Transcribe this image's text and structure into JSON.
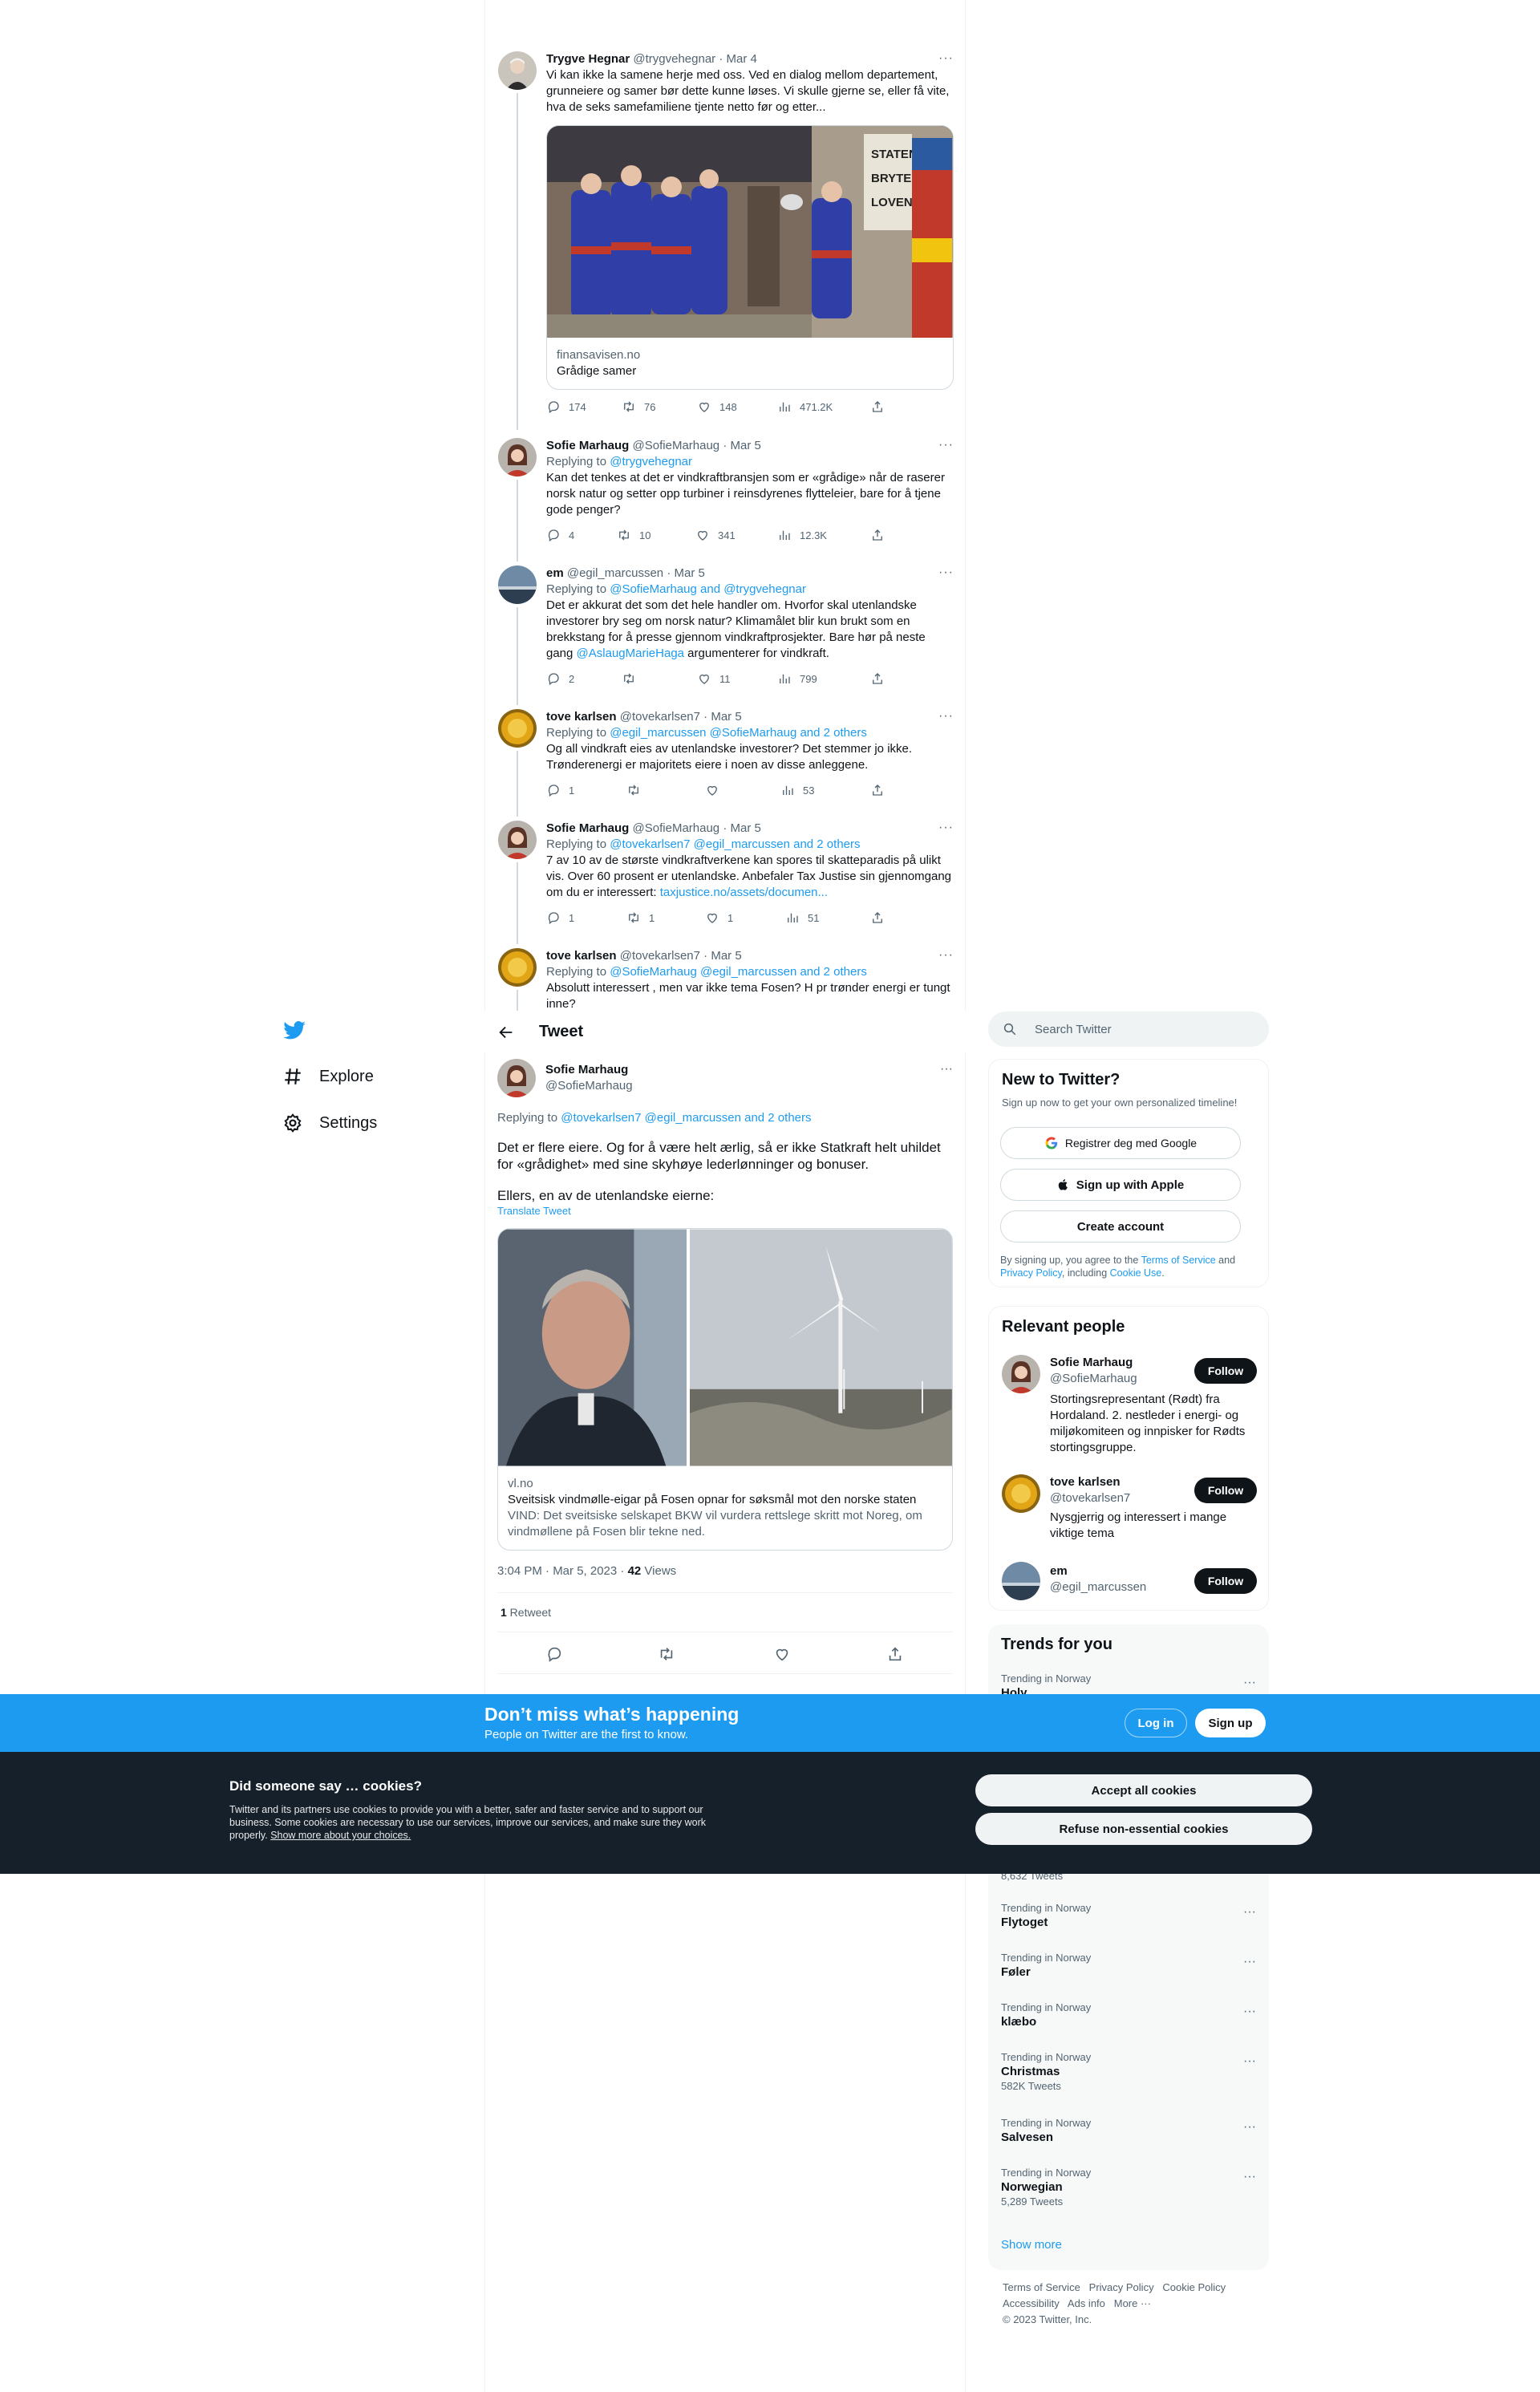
{
  "thread": [
    {
      "name": "Trygve Hegnar",
      "handle": "@trygvehegnar",
      "date": "· Mar 4",
      "text": "Vi kan ikke la samene herje med oss. Ved en dialog mellom departement, grunneiere og samer bør dette kunne løses. Vi skulle gjerne se, eller få vite, hva de seks samefamiliene tjente netto før og etter...",
      "card_domain": "finansavisen.no",
      "card_title": "Grådige samer",
      "counts": {
        "reply": "174",
        "retweet": "76",
        "like": "148",
        "views": "471.2K"
      }
    },
    {
      "name": "Sofie Marhaug",
      "handle": "@SofieMarhaug",
      "date": "· Mar 5",
      "replying_prefix": "Replying to ",
      "replying_to": "@trygvehegnar",
      "text": "Kan det tenkes at det er vindkraftbransjen som er «grådige» når de raserer norsk natur og setter opp turbiner i reinsdyrenes flytteleier, bare for å tjene gode penger?",
      "counts": {
        "reply": "4",
        "retweet": "10",
        "like": "341",
        "views": "12.3K"
      }
    },
    {
      "name": "em",
      "handle": "@egil_marcussen",
      "date": "· Mar 5",
      "replying_prefix": "Replying to ",
      "replying_to": "@SofieMarhaug and @trygvehegnar",
      "text_a": "Det er akkurat det som det hele handler om. Hvorfor skal utenlandske investorer bry seg om norsk natur? Klimamålet blir kun brukt som en brekkstang for å presse gjennom vindkraftprosjekter. Bare hør på neste gang ",
      "mention": "@AslaugMarieHaga",
      "text_b": " argumenterer for vindkraft.",
      "counts": {
        "reply": "2",
        "retweet": "",
        "like": "11",
        "views": "799"
      }
    },
    {
      "name": "tove karlsen",
      "handle": "@tovekarlsen7",
      "date": "· Mar 5",
      "replying_prefix": "Replying to ",
      "replying_to": "@egil_marcussen @SofieMarhaug and 2 others",
      "text": "Og all vindkraft eies av utenlandske investorer? Det stemmer jo ikke. Trønderenergi er majoritets eiere i noen av disse anleggene.",
      "counts": {
        "reply": "1",
        "retweet": "",
        "like": "",
        "views": "53"
      }
    },
    {
      "name": "Sofie Marhaug",
      "handle": "@SofieMarhaug",
      "date": "· Mar 5",
      "replying_prefix": "Replying to ",
      "replying_to": "@tovekarlsen7 @egil_marcussen and 2 others",
      "text_a": "7 av 10 av de største vindkraftverkene kan spores til skatteparadis på ulikt vis. Over 60 prosent er utenlandske. Anbefaler Tax Justise sin gjennomgang om du er interessert: ",
      "link": "taxjustice.no/assets/documen...",
      "counts": {
        "reply": "1",
        "retweet": "1",
        "like": "1",
        "views": "51"
      }
    },
    {
      "name": "tove karlsen",
      "handle": "@tovekarlsen7",
      "date": "· Mar 5",
      "replying_prefix": "Replying to ",
      "replying_to": "@SofieMarhaug @egil_marcussen and 2 others",
      "text": "Absolutt interessert , men var ikke tema Fosen? H pr trønder energi er tungt inne?"
    }
  ],
  "nav": {
    "explore": "Explore",
    "settings": "Settings"
  },
  "focus": {
    "header": "Tweet",
    "name": "Sofie Marhaug",
    "handle": "@SofieMarhaug",
    "replying_prefix": "Replying to ",
    "replying_to": "@tovekarlsen7 @egil_marcussen and 2 others",
    "text_1": "Det er flere eiere. Og for å være helt ærlig, så er ikke Statkraft helt uhildet for «grådighet» med sine skyhøye lederlønninger og bonuser.",
    "text_2": "Ellers, en av de utenlandske eierne:",
    "translate": "Translate Tweet",
    "card_domain": "vl.no",
    "card_title": "Sveitsisk vindmølle-eigar på Fosen opnar for søksmål mot den norske staten",
    "card_desc": "VIND: Det sveitsiske selskapet BKW vil vurdera rettslege skritt mot Noreg, om vindmøllene på Fosen blir tekne ned.",
    "timestamp": "3:04 PM · Mar 5, 2023 · ",
    "views_count": "42",
    "views_label": " Views",
    "retweet_count": "1",
    "retweet_label": " Retweet"
  },
  "search": {
    "placeholder": "Search Twitter"
  },
  "new_to_twitter": {
    "title": "New to Twitter?",
    "subtitle": "Sign up now to get your own personalized timeline!",
    "google": "Registrer deg med Google",
    "apple": "Sign up with Apple",
    "create": "Create account",
    "terms_a": "By signing up, you agree to the ",
    "terms_link": "Terms of Service",
    "terms_b": " and ",
    "privacy_link": "Privacy Policy",
    "terms_c": ", including ",
    "cookie_link": "Cookie Use",
    "terms_d": "."
  },
  "relevant": {
    "title": "Relevant people",
    "follow": "Follow",
    "people": [
      {
        "name": "Sofie Marhaug",
        "handle": "@SofieMarhaug",
        "bio": "Stortingsrepresentant (Rødt) fra Hordaland. 2. nestleder i energi- og miljøkomiteen og innpisker for Rødts stortingsgruppe."
      },
      {
        "name": "tove karlsen",
        "handle": "@tovekarlsen7",
        "bio": "Nysgjerrig og interessert i mange viktige tema"
      },
      {
        "name": "em",
        "handle": "@egil_marcussen",
        "bio": ""
      }
    ]
  },
  "trends": {
    "title": "Trends for you",
    "items": [
      {
        "context": "Trending in Norway",
        "name": "Holy",
        "count": ""
      },
      {
        "context": "",
        "name": "",
        "count": "8,632 Tweets"
      },
      {
        "context": "Trending in Norway",
        "name": "Flytoget",
        "count": ""
      },
      {
        "context": "Trending in Norway",
        "name": "Føler",
        "count": ""
      },
      {
        "context": "Trending in Norway",
        "name": "klæbo",
        "count": ""
      },
      {
        "context": "Trending in Norway",
        "name": "Christmas",
        "count": "582K Tweets"
      },
      {
        "context": "Trending in Norway",
        "name": "Salvesen",
        "count": ""
      },
      {
        "context": "Trending in Norway",
        "name": "Norwegian",
        "count": "5,289 Tweets"
      }
    ],
    "show_more": "Show more"
  },
  "footer": {
    "terms": "Terms of Service",
    "privacy": "Privacy Policy",
    "cookie": "Cookie Policy",
    "accessibility": "Accessibility",
    "ads": "Ads info",
    "more": "More ···",
    "copyright": "© 2023 Twitter, Inc."
  },
  "banner": {
    "title": "Don’t miss what’s happening",
    "subtitle": "People on Twitter are the first to know.",
    "login": "Log in",
    "signup": "Sign up"
  },
  "cookie": {
    "title": "Did someone say … cookies?",
    "text": "Twitter and its partners use cookies to provide you with a better, safer and faster service and to support our business. Some cookies are necessary to use our services, improve our services, and make sure they work properly. ",
    "link": "Show more about your choices.",
    "accept": "Accept all cookies",
    "refuse": "Refuse non-essential cookies"
  },
  "colors": {
    "accent": "#1d9bf0",
    "dark": "#0f1419",
    "muted": "#536471",
    "cookie_bg": "#15202b"
  }
}
